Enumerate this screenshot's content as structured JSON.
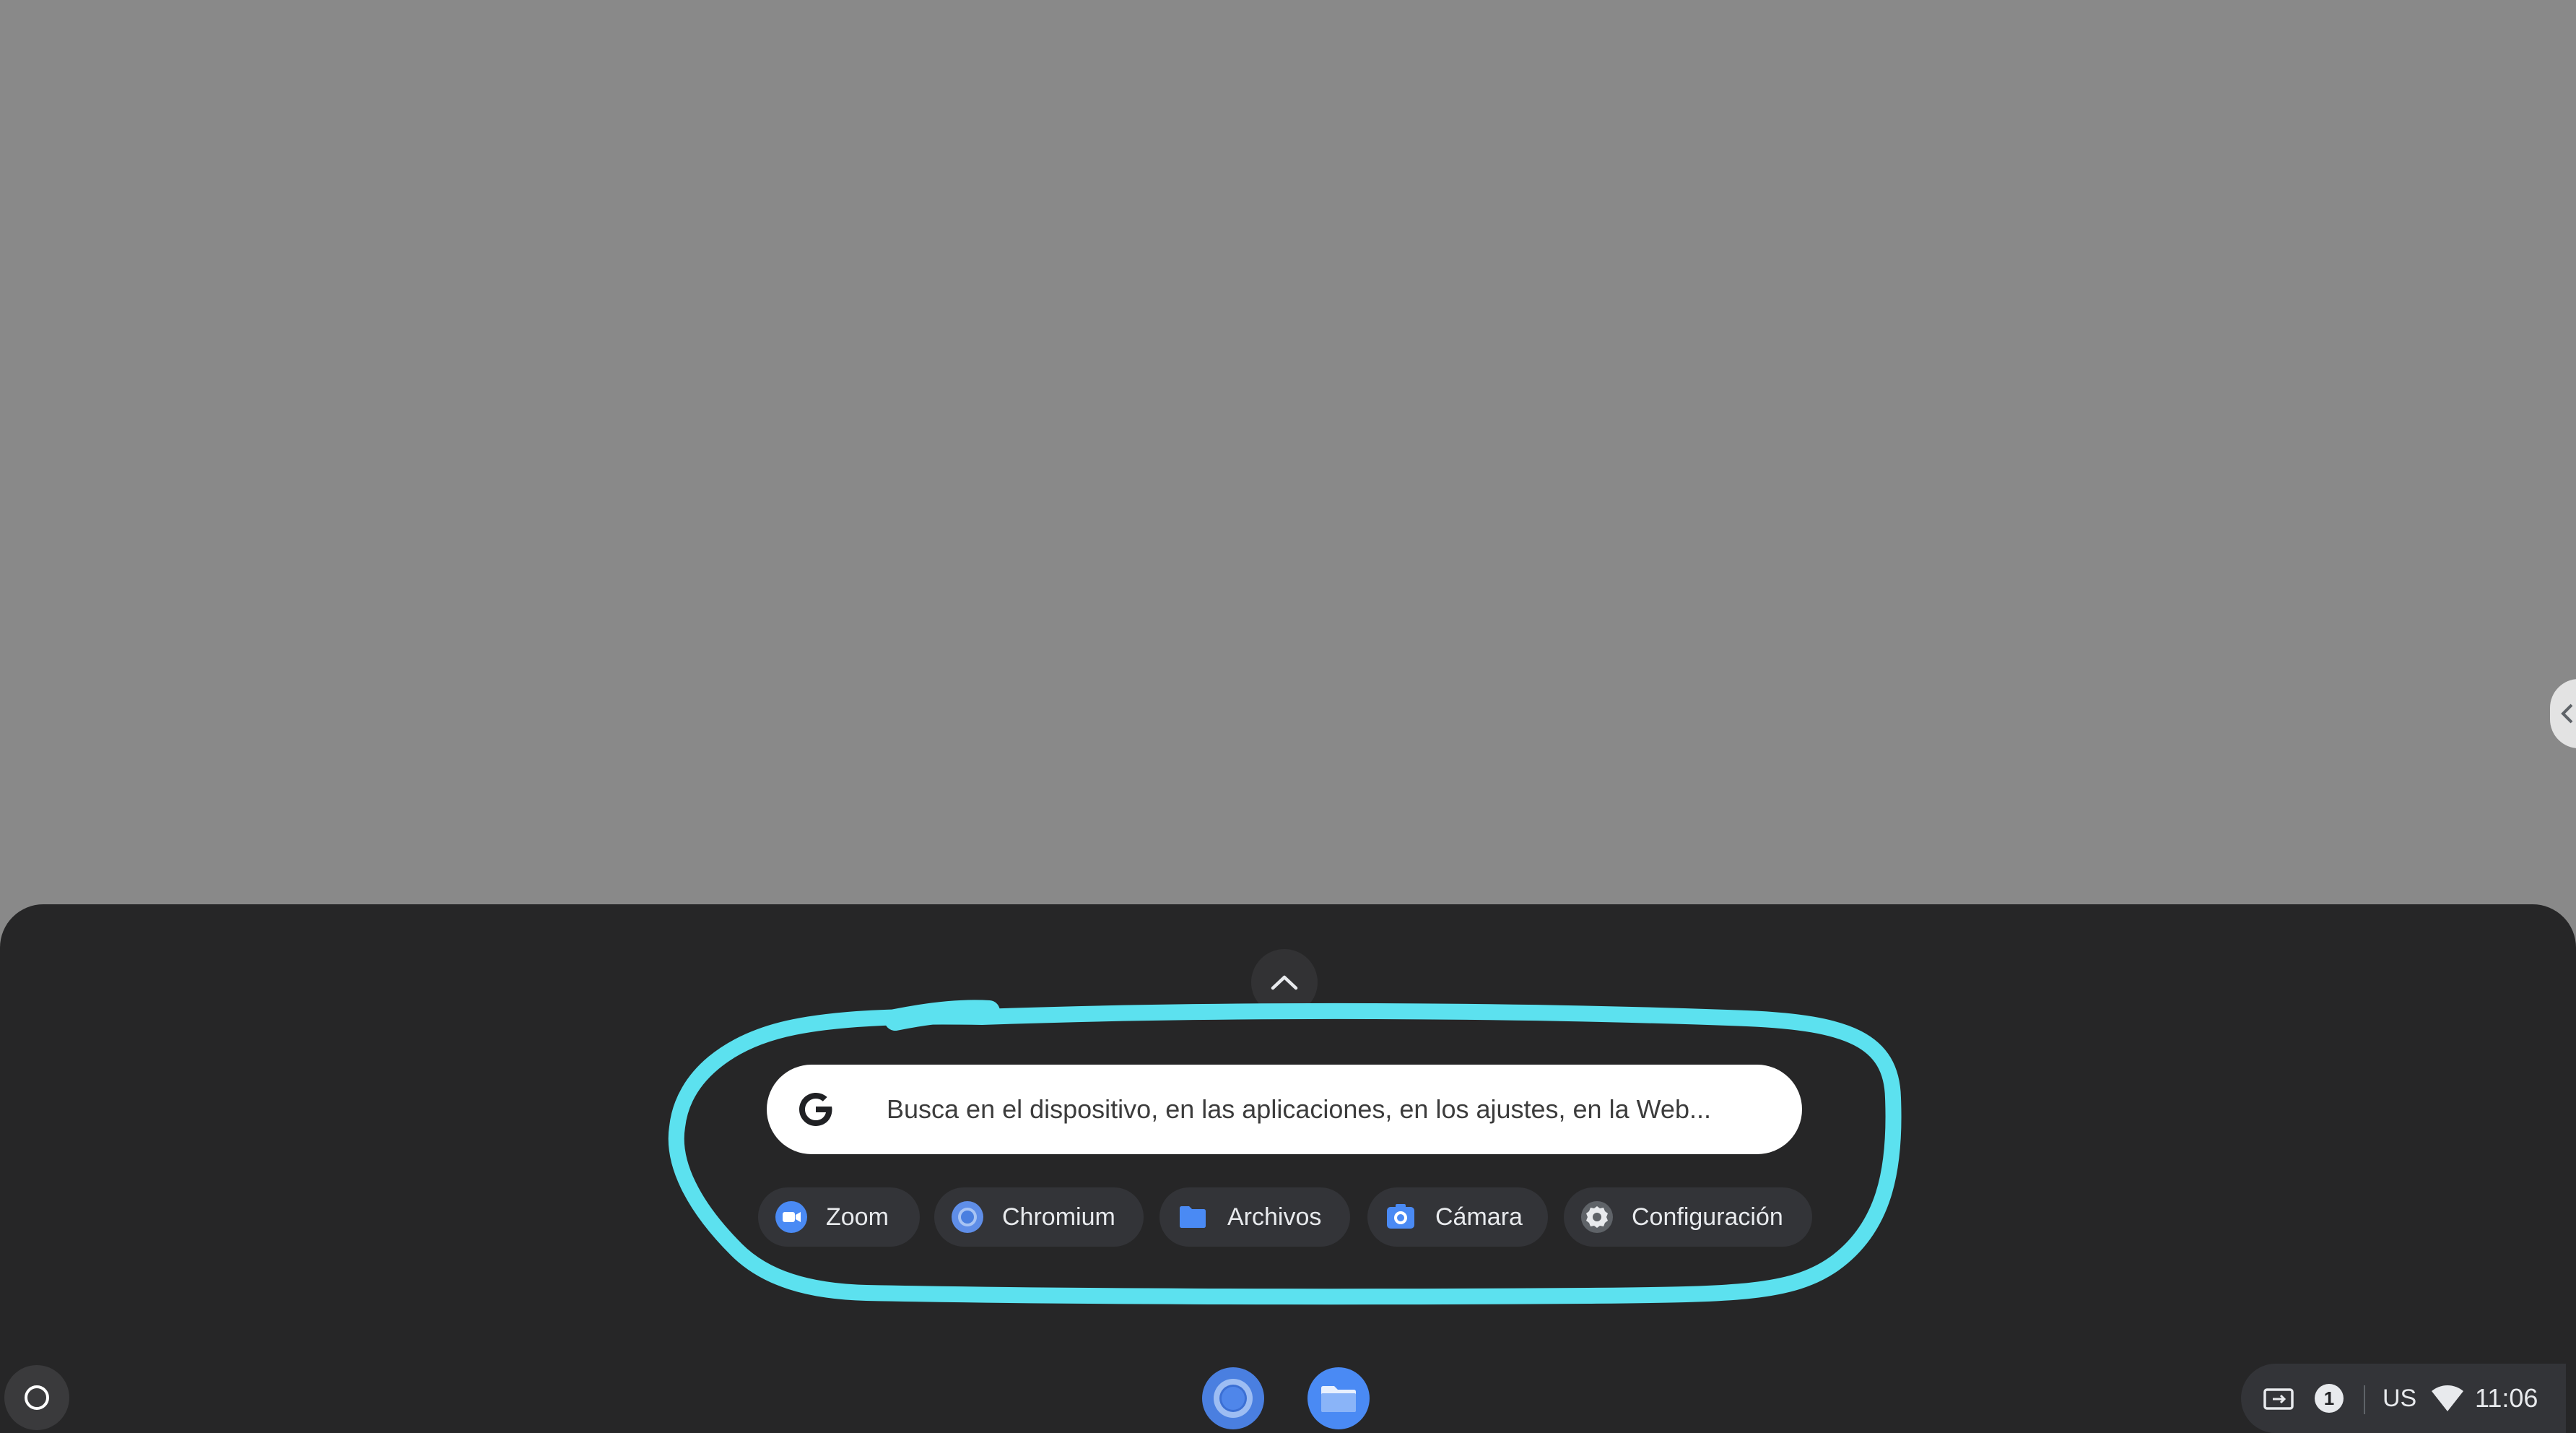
{
  "search": {
    "placeholder": "Busca en el dispositivo, en las aplicaciones, en los ajustes, en la Web..."
  },
  "suggestions": [
    {
      "label": "Zoom",
      "icon": "zoom-icon"
    },
    {
      "label": "Chromium",
      "icon": "chromium-icon"
    },
    {
      "label": "Archivos",
      "icon": "files-icon"
    },
    {
      "label": "Cámara",
      "icon": "camera-icon"
    },
    {
      "label": "Configuración",
      "icon": "settings-icon"
    }
  ],
  "shelf": {
    "apps": [
      {
        "icon": "chromium-icon"
      },
      {
        "icon": "files-icon"
      }
    ]
  },
  "status": {
    "notification_count": "1",
    "keyboard_layout": "US",
    "time": "11:06"
  },
  "colors": {
    "wallpaper": "#898989",
    "launcher_bg": "#262627",
    "chip_bg": "#333438",
    "annotation": "#5ce1ef",
    "accent_blue": "#4285f4"
  }
}
